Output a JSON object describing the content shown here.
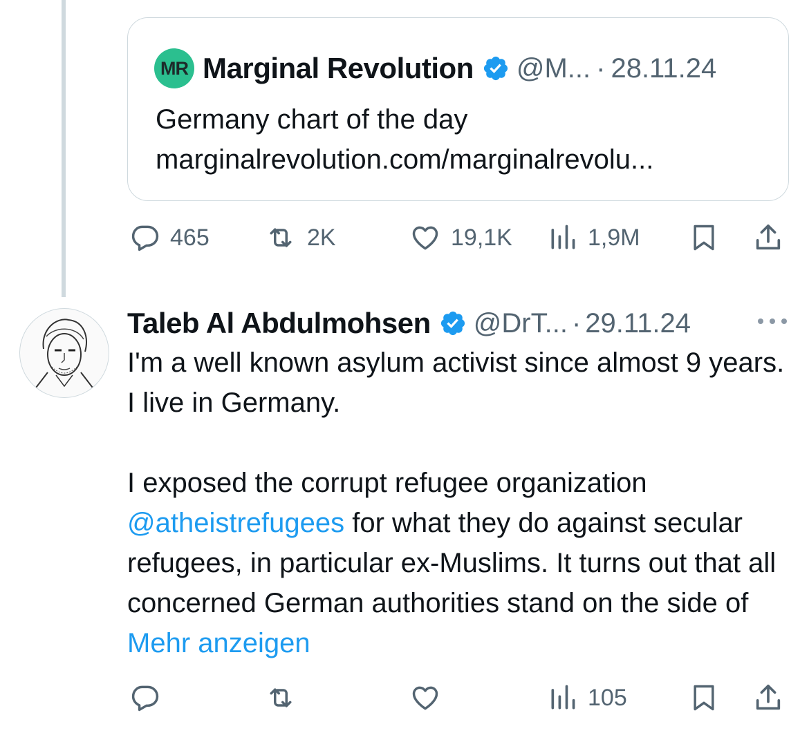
{
  "quoted_tweet": {
    "logo_text": "MR",
    "author_name": "Marginal Revolution",
    "handle": "@M...",
    "separator": "·",
    "date": "28.11.24",
    "text": "Germany chart of the day\nmarginalrevolution.com/marginalrevolu..."
  },
  "action_bar_1": {
    "replies": "465",
    "retweets": "2K",
    "likes": "19,1K",
    "views": "1,9M"
  },
  "tweet": {
    "author_name": "Taleb Al Abdulmohsen",
    "handle": "@DrT...",
    "separator": "·",
    "date": "29.11.24",
    "text_part1": "I'm a well known asylum activist since almost 9 years. I live in Germany.",
    "text_part2_before": "I exposed the corrupt refugee organization ",
    "mention": "@atheistrefugees",
    "text_part2_after": " for what they do against secular refugees, in particular ex-Muslims. It turns out that all concerned German authorities stand on the side of ",
    "show_more": "Mehr anzeigen"
  },
  "action_bar_2": {
    "views": "105"
  },
  "colors": {
    "link": "#1d9bf0",
    "verified": "#1d9bf0",
    "muted": "#536471",
    "logo_bg": "#2bbf8f"
  },
  "icons": [
    "reply-icon",
    "retweet-icon",
    "like-icon",
    "views-icon",
    "bookmark-icon",
    "share-icon",
    "verified-badge-icon",
    "more-options-icon"
  ]
}
